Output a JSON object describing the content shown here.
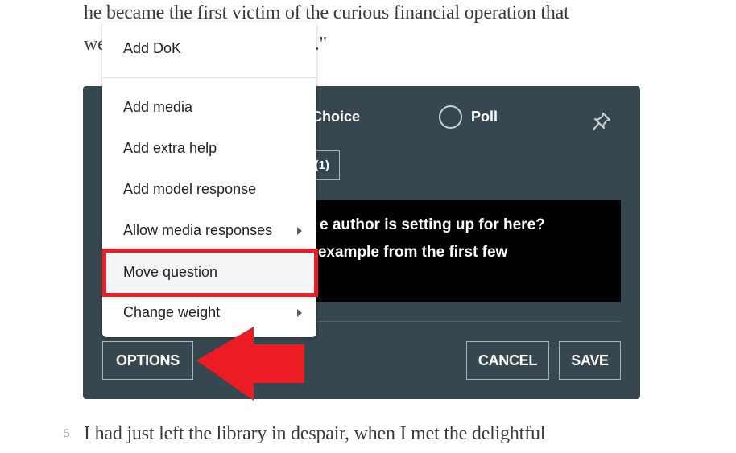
{
  "document": {
    "line1": "he became the first victim of the curious financial operation that",
    "line2": "we                              envelope.\"",
    "line3": "I had just left the library in despair, when I met the delightful",
    "line3_number": "5"
  },
  "question_editor": {
    "question_types": [
      {
        "label": "ltiple Choice",
        "selected": false
      },
      {
        "label": "Poll",
        "selected": false
      }
    ],
    "answer_count_label": "(1)",
    "question_text_lines": [
      "e author is setting up for here?",
      "y example from the first few"
    ],
    "buttons": {
      "options": "OPTIONS",
      "cancel": "CANCEL",
      "save": "SAVE"
    },
    "colors": {
      "panel_bg": "#36474f",
      "question_bg": "#000000",
      "annotation_red": "#ec1c24"
    }
  },
  "options_menu": {
    "items": [
      {
        "label": "Add DoK",
        "has_submenu": false
      },
      {
        "label": "Add media",
        "has_submenu": false
      },
      {
        "label": "Add extra help",
        "has_submenu": false
      },
      {
        "label": "Add model response",
        "has_submenu": false
      },
      {
        "label": "Allow media responses",
        "has_submenu": true
      },
      {
        "label": "Move question",
        "has_submenu": false,
        "highlighted": true
      },
      {
        "label": "Change weight",
        "has_submenu": true
      }
    ]
  }
}
